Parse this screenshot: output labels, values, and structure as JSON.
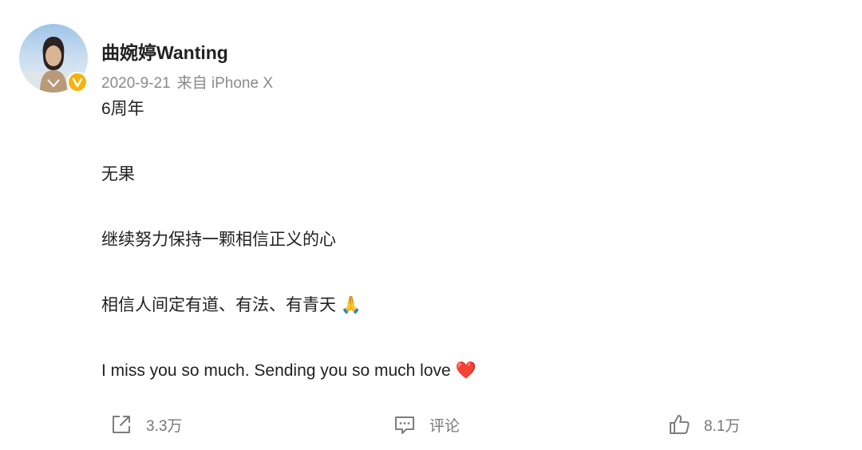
{
  "post": {
    "author": {
      "name": "曲婉婷Wanting",
      "verified": true,
      "badge_color": "#f6b30e"
    },
    "date": "2020-9-21",
    "source": "来自 iPhone X",
    "lines": [
      "6周年",
      "无果",
      "继续努力保持一颗相信正义的心",
      "相信人间定有道、有法、有青天 🙏",
      "I miss you so much. Sending you so much love ❤️"
    ]
  },
  "actions": {
    "share": {
      "icon": "share-icon",
      "count": "3.3万"
    },
    "comment": {
      "icon": "comment-icon",
      "label": "评论"
    },
    "like": {
      "icon": "thumbs-up-icon",
      "count": "8.1万"
    }
  }
}
